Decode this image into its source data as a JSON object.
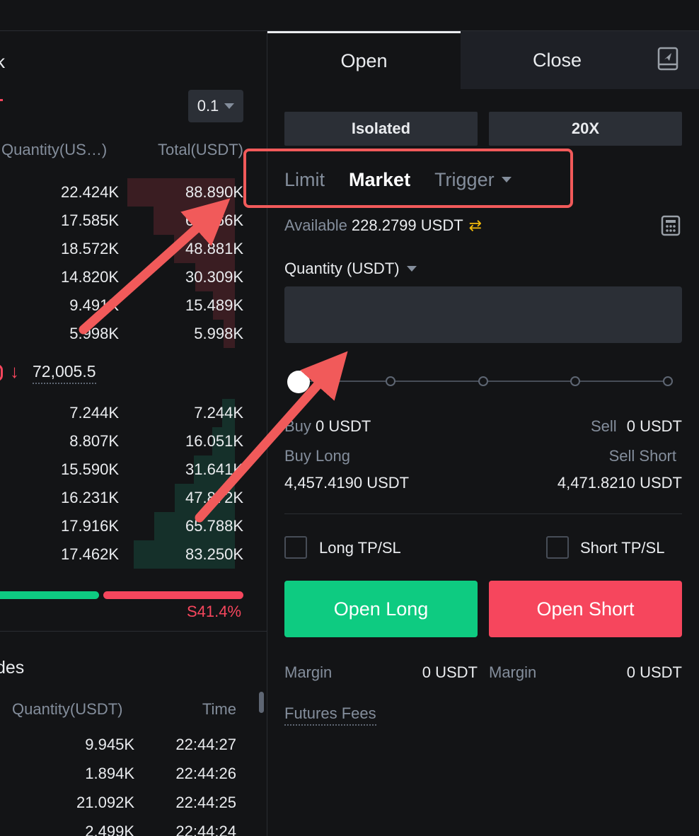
{
  "orderbook": {
    "title_fragment": "k",
    "step_value": "0.1",
    "col_quantity": "Quantity(US…)",
    "col_total": "Total(USDT)",
    "asks": [
      {
        "q": "22.424K",
        "t": "88.890K"
      },
      {
        "q": "17.585K",
        "t": "66.466K"
      },
      {
        "q": "18.572K",
        "t": "48.881K"
      },
      {
        "q": "14.820K",
        "t": "30.309K"
      },
      {
        "q": "9.491K",
        "t": "15.489K"
      },
      {
        "q": "5.998K",
        "t": "5.998K"
      }
    ],
    "mid_price": "72,005.5",
    "mid_arrow": "↓",
    "bids": [
      {
        "q": "7.244K",
        "t": "7.244K"
      },
      {
        "q": "8.807K",
        "t": "16.051K"
      },
      {
        "q": "15.590K",
        "t": "31.641K"
      },
      {
        "q": "16.231K",
        "t": "47.872K"
      },
      {
        "q": "17.916K",
        "t": "65.788K"
      },
      {
        "q": "17.462K",
        "t": "83.250K"
      }
    ],
    "sell_ratio_label": "S41.4%",
    "sell_ratio": 0.414
  },
  "trades": {
    "title_fragment": "des",
    "col_quantity": "Quantity(USDT)",
    "col_time": "Time",
    "rows": [
      {
        "q": "9.945K",
        "time": "22:44:27"
      },
      {
        "q": "1.894K",
        "time": "22:44:26"
      },
      {
        "q": "21.092K",
        "time": "22:44:25"
      },
      {
        "q": "2.499K",
        "time": "22:44:24"
      }
    ]
  },
  "form": {
    "tab_open": "Open",
    "tab_close": "Close",
    "margin_mode": "Isolated",
    "leverage": "20X",
    "order_types": {
      "limit": "Limit",
      "market": "Market",
      "trigger": "Trigger"
    },
    "active_order_type": "Market",
    "available_label": "Available",
    "available_value": "228.2799 USDT",
    "quantity_label": "Quantity (USDT)",
    "quantity_value": "",
    "slider_percent": 0,
    "buy_label": "Buy",
    "buy_value": "0 USDT",
    "sell_label": "Sell",
    "sell_value": "0 USDT",
    "buy_long_label": "Buy Long",
    "buy_long_value": "4,457.4190 USDT",
    "sell_short_label": "Sell Short",
    "sell_short_value": "4,471.8210 USDT",
    "long_tpsl": "Long TP/SL",
    "short_tpsl": "Short TP/SL",
    "open_long": "Open Long",
    "open_short": "Open Short",
    "margin_label": "Margin",
    "margin_long_value": "0 USDT",
    "margin_short_value": "0 USDT",
    "futures_fees": "Futures Fees"
  },
  "colors": {
    "background": "#131416",
    "buy_green": "#0ecb81",
    "sell_red": "#f6465d",
    "annotation_red": "#f15a5a",
    "accent_yellow": "#f0b90b"
  },
  "icons": [
    "book-icon",
    "calculator-icon",
    "swap-icon",
    "caret-down-icon"
  ]
}
